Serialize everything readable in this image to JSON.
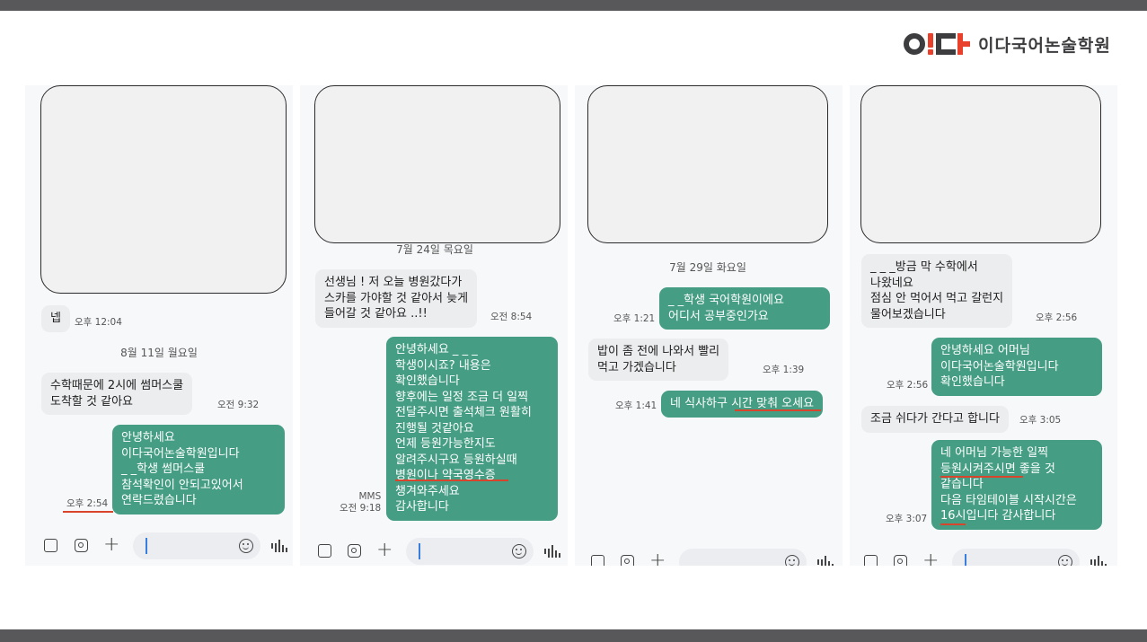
{
  "brand": {
    "name": "이다국어논술학원",
    "accent": "#e8402a",
    "dark": "#3d3d3f"
  },
  "colors": {
    "outgoing_bubble": "#459d83",
    "incoming_bubble": "#ecedef",
    "underline": "#d9442c"
  },
  "panels": [
    {
      "photo_placeholder": "",
      "messages": [
        {
          "text": "넵",
          "time": "오후 12:04"
        },
        {
          "date": "8월 11일 월요일"
        },
        {
          "text": "수학때문에 2시에 썸머스쿨\n도착할 것 같아요",
          "time": "오전 9:32"
        },
        {
          "text": "안녕하세요\n이다국어논술학원입니다\n_ _학생 썸머스쿨\n참석확인이 안되고있어서\n연락드렸습니다",
          "time": "오후 2:54"
        }
      ],
      "icons": [
        "gallery-icon",
        "camera-icon",
        "plus-icon",
        "emoji-icon",
        "voice-icon"
      ]
    },
    {
      "messages": [
        {
          "date": "7월 24일 목요일"
        },
        {
          "text": "선생님 ! 저 오늘 병원갔다가\n스카를 가야할 것 같아서 늦게\n들어갈 것 같아요 ..!!",
          "time": "오전 8:54"
        },
        {
          "text": "안녕하세요 _ _ _\n학생이시죠? 내용은\n확인했습니다\n향후에는 일정 조금 더 일찍\n전달주시면 출석체크 원활히\n진행될 것같아요\n언제 등원가능한지도\n알려주시구요 등원하실때\n병원이나 약국영수증\n챙겨와주세요\n감사합니다",
          "time": "MMS\n오전 9:18"
        }
      ]
    },
    {
      "messages": [
        {
          "date": "7월 29일 화요일"
        },
        {
          "text": "_ _학생 국어학원이에요\n어디서 공부중인가요",
          "time": "오후 1:21"
        },
        {
          "text": "밥이 좀 전에 나와서 빨리\n먹고 가겠습니다",
          "time": "오후 1:39"
        },
        {
          "text": "네 식사하구 시간 맞춰 오세요",
          "time": "오후 1:41"
        }
      ]
    },
    {
      "messages": [
        {
          "text": "_ _ _방금 막 수학에서\n나왔네요\n점심 안 먹어서 먹고 갈런지\n물어보겠습니다",
          "time": "오후 2:56"
        },
        {
          "text": "안녕하세요 어머님\n이다국어논술학원입니다\n확인했습니다",
          "time": "오후 2:56"
        },
        {
          "text": "조금 쉬다가 간다고 합니다",
          "time": "오후 3:05"
        },
        {
          "text": "네 어머님 가능한 일찍\n등원시켜주시면 좋을 것\n같습니다\n다음 타임테이블 시작시간은\n16시입니다 감사합니다",
          "time": "오후 3:07"
        }
      ]
    }
  ]
}
